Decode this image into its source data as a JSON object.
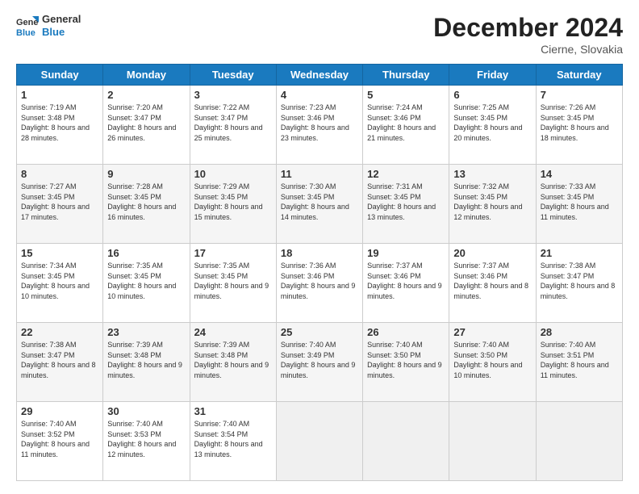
{
  "logo": {
    "line1": "General",
    "line2": "Blue"
  },
  "title": {
    "month_year": "December 2024",
    "location": "Cierne, Slovakia"
  },
  "headers": [
    "Sunday",
    "Monday",
    "Tuesday",
    "Wednesday",
    "Thursday",
    "Friday",
    "Saturday"
  ],
  "weeks": [
    [
      {
        "day": "1",
        "sunrise": "7:19 AM",
        "sunset": "3:48 PM",
        "daylight": "8 hours and 28 minutes."
      },
      {
        "day": "2",
        "sunrise": "7:20 AM",
        "sunset": "3:47 PM",
        "daylight": "8 hours and 26 minutes."
      },
      {
        "day": "3",
        "sunrise": "7:22 AM",
        "sunset": "3:47 PM",
        "daylight": "8 hours and 25 minutes."
      },
      {
        "day": "4",
        "sunrise": "7:23 AM",
        "sunset": "3:46 PM",
        "daylight": "8 hours and 23 minutes."
      },
      {
        "day": "5",
        "sunrise": "7:24 AM",
        "sunset": "3:46 PM",
        "daylight": "8 hours and 21 minutes."
      },
      {
        "day": "6",
        "sunrise": "7:25 AM",
        "sunset": "3:45 PM",
        "daylight": "8 hours and 20 minutes."
      },
      {
        "day": "7",
        "sunrise": "7:26 AM",
        "sunset": "3:45 PM",
        "daylight": "8 hours and 18 minutes."
      }
    ],
    [
      {
        "day": "8",
        "sunrise": "7:27 AM",
        "sunset": "3:45 PM",
        "daylight": "8 hours and 17 minutes."
      },
      {
        "day": "9",
        "sunrise": "7:28 AM",
        "sunset": "3:45 PM",
        "daylight": "8 hours and 16 minutes."
      },
      {
        "day": "10",
        "sunrise": "7:29 AM",
        "sunset": "3:45 PM",
        "daylight": "8 hours and 15 minutes."
      },
      {
        "day": "11",
        "sunrise": "7:30 AM",
        "sunset": "3:45 PM",
        "daylight": "8 hours and 14 minutes."
      },
      {
        "day": "12",
        "sunrise": "7:31 AM",
        "sunset": "3:45 PM",
        "daylight": "8 hours and 13 minutes."
      },
      {
        "day": "13",
        "sunrise": "7:32 AM",
        "sunset": "3:45 PM",
        "daylight": "8 hours and 12 minutes."
      },
      {
        "day": "14",
        "sunrise": "7:33 AM",
        "sunset": "3:45 PM",
        "daylight": "8 hours and 11 minutes."
      }
    ],
    [
      {
        "day": "15",
        "sunrise": "7:34 AM",
        "sunset": "3:45 PM",
        "daylight": "8 hours and 10 minutes."
      },
      {
        "day": "16",
        "sunrise": "7:35 AM",
        "sunset": "3:45 PM",
        "daylight": "8 hours and 10 minutes."
      },
      {
        "day": "17",
        "sunrise": "7:35 AM",
        "sunset": "3:45 PM",
        "daylight": "8 hours and 9 minutes."
      },
      {
        "day": "18",
        "sunrise": "7:36 AM",
        "sunset": "3:46 PM",
        "daylight": "8 hours and 9 minutes."
      },
      {
        "day": "19",
        "sunrise": "7:37 AM",
        "sunset": "3:46 PM",
        "daylight": "8 hours and 9 minutes."
      },
      {
        "day": "20",
        "sunrise": "7:37 AM",
        "sunset": "3:46 PM",
        "daylight": "8 hours and 8 minutes."
      },
      {
        "day": "21",
        "sunrise": "7:38 AM",
        "sunset": "3:47 PM",
        "daylight": "8 hours and 8 minutes."
      }
    ],
    [
      {
        "day": "22",
        "sunrise": "7:38 AM",
        "sunset": "3:47 PM",
        "daylight": "8 hours and 8 minutes."
      },
      {
        "day": "23",
        "sunrise": "7:39 AM",
        "sunset": "3:48 PM",
        "daylight": "8 hours and 9 minutes."
      },
      {
        "day": "24",
        "sunrise": "7:39 AM",
        "sunset": "3:48 PM",
        "daylight": "8 hours and 9 minutes."
      },
      {
        "day": "25",
        "sunrise": "7:40 AM",
        "sunset": "3:49 PM",
        "daylight": "8 hours and 9 minutes."
      },
      {
        "day": "26",
        "sunrise": "7:40 AM",
        "sunset": "3:50 PM",
        "daylight": "8 hours and 9 minutes."
      },
      {
        "day": "27",
        "sunrise": "7:40 AM",
        "sunset": "3:50 PM",
        "daylight": "8 hours and 10 minutes."
      },
      {
        "day": "28",
        "sunrise": "7:40 AM",
        "sunset": "3:51 PM",
        "daylight": "8 hours and 11 minutes."
      }
    ],
    [
      {
        "day": "29",
        "sunrise": "7:40 AM",
        "sunset": "3:52 PM",
        "daylight": "8 hours and 11 minutes."
      },
      {
        "day": "30",
        "sunrise": "7:40 AM",
        "sunset": "3:53 PM",
        "daylight": "8 hours and 12 minutes."
      },
      {
        "day": "31",
        "sunrise": "7:40 AM",
        "sunset": "3:54 PM",
        "daylight": "8 hours and 13 minutes."
      },
      null,
      null,
      null,
      null
    ]
  ],
  "labels": {
    "sunrise": "Sunrise:",
    "sunset": "Sunset:",
    "daylight": "Daylight:"
  }
}
